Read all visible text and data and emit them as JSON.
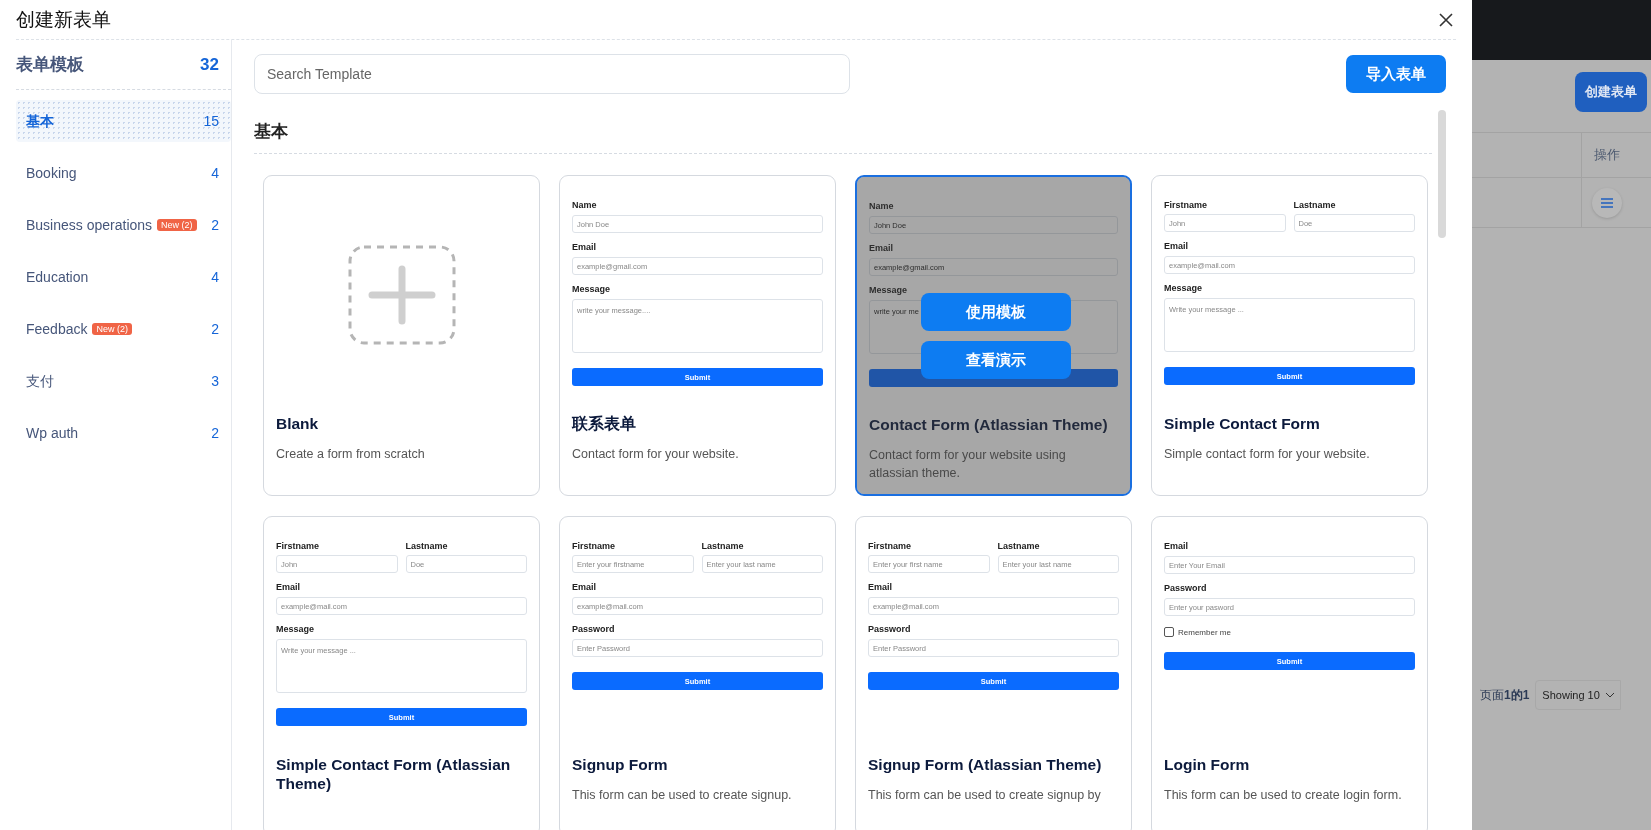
{
  "modal": {
    "title": "创建新表单"
  },
  "sidebar": {
    "title": "表单模板",
    "count": "32",
    "items": [
      {
        "label": "基本",
        "count": "15",
        "selected": true
      },
      {
        "label": "Booking",
        "count": "4",
        "selected": false
      },
      {
        "label": "Business operations",
        "badge": "New (2)",
        "count": "2",
        "selected": false
      },
      {
        "label": "Education",
        "count": "4",
        "selected": false
      },
      {
        "label": "Feedback",
        "badge": "New (2)",
        "count": "2",
        "selected": false
      },
      {
        "label": "支付",
        "count": "3",
        "selected": false
      },
      {
        "label": "Wp auth",
        "count": "2",
        "selected": false
      }
    ]
  },
  "search": {
    "placeholder": "Search Template"
  },
  "import_button": "导入表单",
  "section_title": "基本",
  "cards": [
    {
      "kind": "blank",
      "title": "Blank",
      "description": "Create a form from scratch",
      "hovered": false
    },
    {
      "kind": "form",
      "title": "联系表单",
      "description": "Contact form for your website.",
      "hovered": false,
      "preview": [
        {
          "kind": "field",
          "label": "Name",
          "placeholder": "John Doe"
        },
        {
          "kind": "field",
          "label": "Email",
          "placeholder": "example@gmail.com"
        },
        {
          "kind": "textarea",
          "label": "Message",
          "placeholder": "write your message...."
        },
        {
          "kind": "submit",
          "label": "Submit"
        }
      ]
    },
    {
      "kind": "form",
      "title": "Contact Form (Atlassian Theme)",
      "description": "Contact form for your website using atlassian theme.",
      "hovered": true,
      "actions": [
        "使用模板",
        "查看演示"
      ],
      "preview": [
        {
          "kind": "field",
          "label": "Name",
          "placeholder": "John Doe"
        },
        {
          "kind": "field",
          "label": "Email",
          "placeholder": "example@gmail.com"
        },
        {
          "kind": "textarea",
          "label": "Message",
          "placeholder": "write your me"
        },
        {
          "kind": "submit"
        }
      ]
    },
    {
      "kind": "form",
      "title": "Simple Contact Form",
      "description": "Simple contact form for your website.",
      "hovered": false,
      "preview": [
        {
          "kind": "pair",
          "fields": [
            {
              "label": "Firstname",
              "placeholder": "John"
            },
            {
              "label": "Lastname",
              "placeholder": "Doe"
            }
          ]
        },
        {
          "kind": "field",
          "label": "Email",
          "placeholder": "example@mail.com"
        },
        {
          "kind": "textarea",
          "label": "Message",
          "placeholder": "Write your message ..."
        },
        {
          "kind": "submit",
          "label": "Submit"
        }
      ]
    },
    {
      "kind": "form",
      "title": "Simple Contact Form (Atlassian Theme)",
      "hovered": false,
      "preview": [
        {
          "kind": "pair",
          "fields": [
            {
              "label": "Firstname",
              "placeholder": "John"
            },
            {
              "label": "Lastname",
              "placeholder": "Doe"
            }
          ]
        },
        {
          "kind": "field",
          "label": "Email",
          "placeholder": "example@mail.com"
        },
        {
          "kind": "textarea",
          "label": "Message",
          "placeholder": "Write your message ..."
        },
        {
          "kind": "submit",
          "label": "Submit"
        }
      ]
    },
    {
      "kind": "form",
      "title": "Signup Form",
      "description": "This form can be used to create signup.",
      "hovered": false,
      "preview": [
        {
          "kind": "pair",
          "fields": [
            {
              "label": "Firstname",
              "placeholder": "Enter your firstname"
            },
            {
              "label": "Lastname",
              "placeholder": "Enter your last name"
            }
          ]
        },
        {
          "kind": "field",
          "label": "Email",
          "placeholder": "example@mail.com"
        },
        {
          "kind": "field",
          "label": "Password",
          "placeholder": "Enter Password"
        },
        {
          "kind": "submit",
          "label": "Submit"
        }
      ]
    },
    {
      "kind": "form",
      "title": "Signup Form (Atlassian Theme)",
      "description": "This form can be used to create signup by",
      "hovered": false,
      "preview": [
        {
          "kind": "pair",
          "fields": [
            {
              "label": "Firstname",
              "placeholder": "Enter your first name"
            },
            {
              "label": "Lastname",
              "placeholder": "Enter your last name"
            }
          ]
        },
        {
          "kind": "field",
          "label": "Email",
          "placeholder": "example@mail.com"
        },
        {
          "kind": "field",
          "label": "Password",
          "placeholder": "Enter Password"
        },
        {
          "kind": "submit",
          "label": "Submit"
        }
      ]
    },
    {
      "kind": "form",
      "title": "Login Form",
      "description": "This form can be used to create login form.",
      "hovered": false,
      "preview": [
        {
          "kind": "field",
          "label": "Email",
          "placeholder": "Enter Your Email"
        },
        {
          "kind": "field",
          "label": "Password",
          "placeholder": "Enter your pasword"
        },
        {
          "kind": "checkbox",
          "label": "Remember me",
          "checked": false
        },
        {
          "kind": "submit",
          "label": "Submit"
        }
      ]
    }
  ],
  "background": {
    "create_button": "创建表单",
    "column_header": "操作",
    "pagination": "页面**1的1**",
    "page_size": "Showing 10"
  }
}
